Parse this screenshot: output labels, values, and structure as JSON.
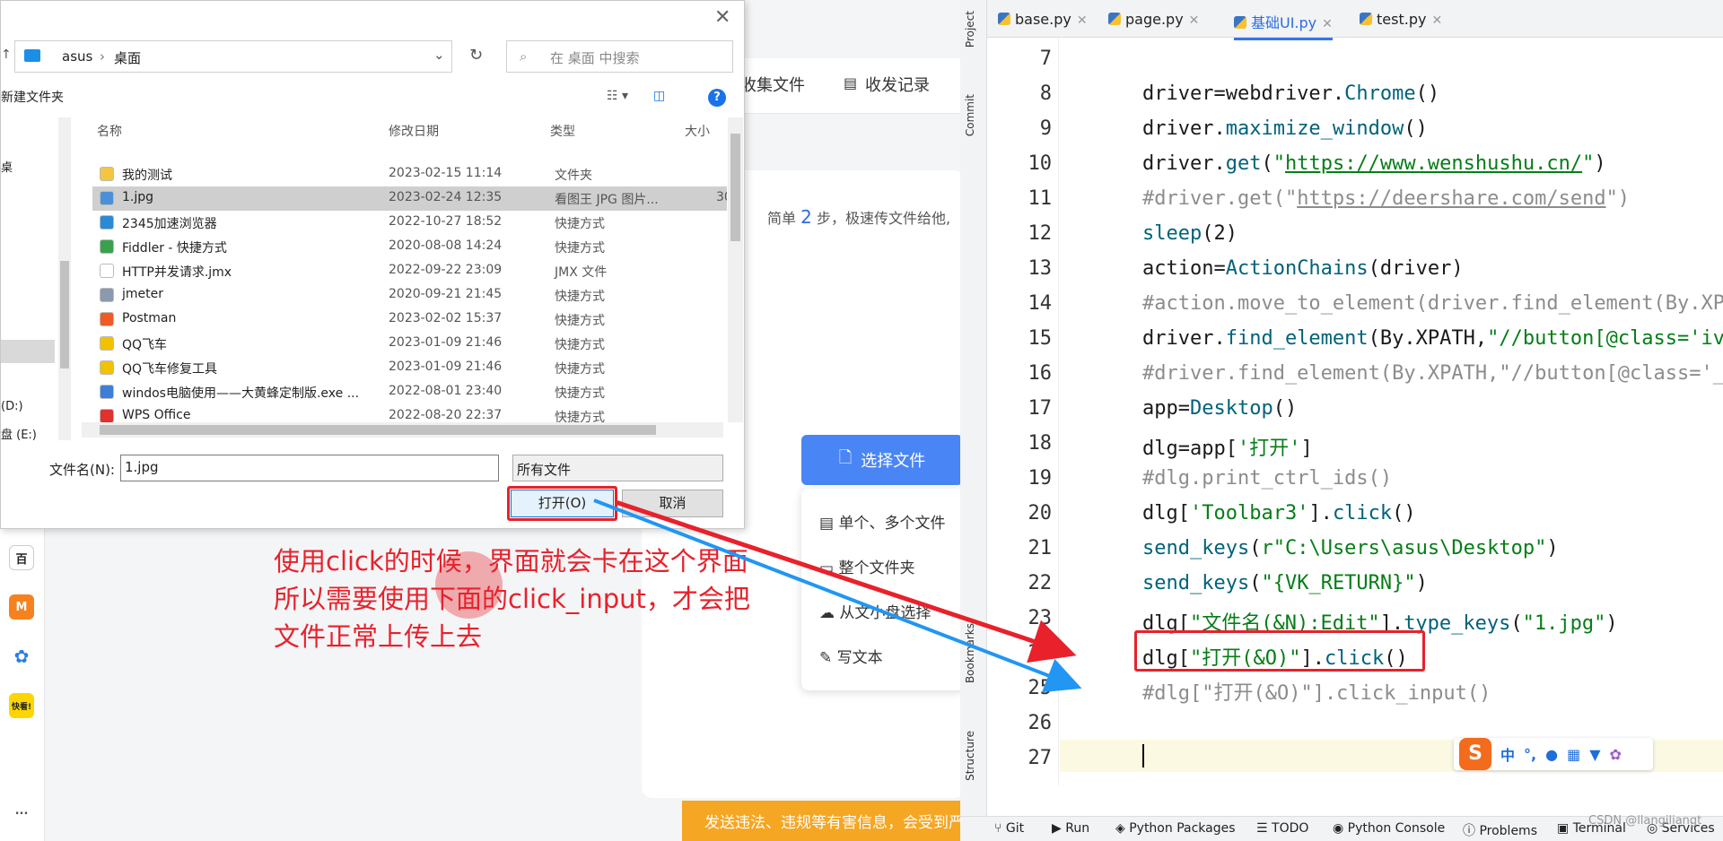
{
  "webpage": {
    "nav": [
      "收集文件",
      "收发记录"
    ],
    "steps_prefix": "简单",
    "steps_num": "2",
    "steps_suffix": "步，极速传文件给他,",
    "choose_button": "选择文件",
    "upload_menu": [
      "单个、多个文件",
      "整个文件夹",
      "从文小盘选择",
      "写文本"
    ],
    "warning": "发送违法、违规等有害信息，会受到严",
    "rail_icons": [
      "百",
      "M",
      "",
      "快看!",
      "..."
    ]
  },
  "dialog": {
    "address": [
      "asus",
      "桌面"
    ],
    "search_placeholder": "在 桌面 中搜索",
    "new_folder": "新建文件夹",
    "nav_items": [
      "桌",
      "(D:)",
      "盘 (E:)"
    ],
    "columns": [
      "名称",
      "修改日期",
      "类型",
      "大小"
    ],
    "files": [
      {
        "name": "我的测试",
        "date": "2023-02-15 11:14",
        "type": "文件夹",
        "size": "",
        "icon": "folder-icon",
        "color": "#f4c542"
      },
      {
        "name": "1.jpg",
        "date": "2023-02-24 12:35",
        "type": "看图王 JPG 图片...",
        "size": "30",
        "icon": "image-icon",
        "color": "#4a90d9"
      },
      {
        "name": "2345加速浏览器",
        "date": "2022-10-27 18:52",
        "type": "快捷方式",
        "size": "",
        "icon": "browser-icon",
        "color": "#2b8ad6"
      },
      {
        "name": "Fiddler - 快捷方式",
        "date": "2020-08-08 14:24",
        "type": "快捷方式",
        "size": "",
        "icon": "fiddler-icon",
        "color": "#3aa14b"
      },
      {
        "name": "HTTP并发请求.jmx",
        "date": "2022-09-22 23:09",
        "type": "JMX 文件",
        "size": "",
        "icon": "file-icon",
        "color": "#ffffff"
      },
      {
        "name": "jmeter",
        "date": "2020-09-21 21:45",
        "type": "快捷方式",
        "size": "",
        "icon": "jmeter-icon",
        "color": "#8a9bb0"
      },
      {
        "name": "Postman",
        "date": "2023-02-02 15:37",
        "type": "快捷方式",
        "size": "",
        "icon": "postman-icon",
        "color": "#ef5b25"
      },
      {
        "name": "QQ飞车",
        "date": "2023-01-09 21:46",
        "type": "快捷方式",
        "size": "",
        "icon": "qq-speed-icon",
        "color": "#f2c200"
      },
      {
        "name": "QQ飞车修复工具",
        "date": "2023-01-09 21:46",
        "type": "快捷方式",
        "size": "",
        "icon": "qq-speed-icon",
        "color": "#f2c200"
      },
      {
        "name": "windos电脑使用——大黄蜂定制版.exe ...",
        "date": "2022-08-01 23:40",
        "type": "快捷方式",
        "size": "",
        "icon": "exe-icon",
        "color": "#3d7fd8"
      },
      {
        "name": "WPS Office",
        "date": "2022-08-20 22:37",
        "type": "快捷方式",
        "size": "",
        "icon": "wps-icon",
        "color": "#e0312e"
      }
    ],
    "filename_label": "文件名(N):",
    "filename_value": "1.jpg",
    "filetype": "所有文件",
    "open_button": "打开(O)",
    "cancel_button": "取消"
  },
  "annotation": [
    "使用click的时候，界面就会卡在这个界面",
    "所以需要使用下面的click_input，才会把",
    "文件正常上传上去"
  ],
  "ide": {
    "side_tabs": [
      "Project",
      "Commit",
      "Bookmarks",
      "Structure"
    ],
    "tabs": [
      "base.py",
      "page.py",
      "基础UI.py",
      "test.py"
    ],
    "active_tab": 2,
    "line_numbers": [
      "7",
      "8",
      "9",
      "10",
      "11",
      "12",
      "13",
      "14",
      "15",
      "16",
      "17",
      "18",
      "19",
      "20",
      "21",
      "22",
      "23",
      "24",
      "25",
      "26",
      "27"
    ],
    "status_items": [
      "Git",
      "Run",
      "Python Packages",
      "TODO",
      "Python Console",
      "Problems",
      "Terminal",
      "Services"
    ],
    "ime": [
      "中",
      "°,",
      "🎤",
      "⌨",
      "👕",
      "⚙"
    ],
    "watermark": "CSDN @llangiliangt"
  }
}
